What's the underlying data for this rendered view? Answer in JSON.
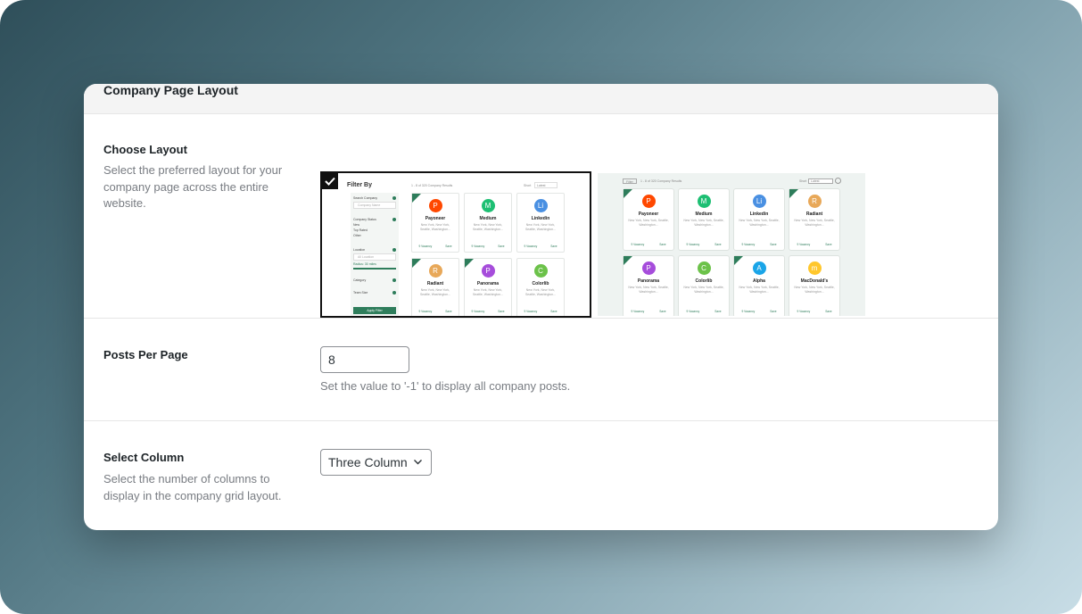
{
  "section": {
    "title": "Company Page Layout"
  },
  "layout": {
    "label": "Choose Layout",
    "description": "Select the preferred layout for your company page across the entire website.",
    "option1": {
      "selected": true,
      "filter_by": "Filter By",
      "sidebar": {
        "search_label": "Search Company",
        "search_placeholder": "Company Name",
        "status_label": "Company Status",
        "status_options": [
          "New",
          "Top Rated",
          "Other"
        ],
        "location_label": "Location",
        "location_placeholder": "All Location",
        "radius_label": "Radius: 30 miles",
        "category_label": "Category",
        "team_size_label": "Team Size",
        "apply_label": "Apply Filter"
      },
      "results_text": "1 - 8 of 320 Company Results",
      "sort_label": "Short",
      "sort_value": "Latest",
      "cards": [
        {
          "name": "Payoneer",
          "logo": "P",
          "color": "#ff4800"
        },
        {
          "name": "Medium",
          "logo": "M",
          "color": "#1dbf73"
        },
        {
          "name": "Linkedin",
          "logo": "Li",
          "color": "#4a90e2"
        },
        {
          "name": "Radiant",
          "logo": "R",
          "color": "#e8a859"
        },
        {
          "name": "Panorama",
          "logo": "P",
          "color": "#a64ddb"
        },
        {
          "name": "Colorlib",
          "logo": "C",
          "color": "#6cc24a"
        }
      ]
    },
    "option2": {
      "selected": false,
      "filter_label": "Filter",
      "results_text": "1 - 8 of 320 Company Results",
      "sort_label": "Short",
      "sort_value": "Latest",
      "cards": [
        {
          "name": "Payoneer",
          "logo": "P",
          "color": "#ff4800"
        },
        {
          "name": "Medium",
          "logo": "M",
          "color": "#1dbf73"
        },
        {
          "name": "Linkedin",
          "logo": "Li",
          "color": "#4a90e2"
        },
        {
          "name": "Radiant",
          "logo": "R",
          "color": "#e8a859"
        },
        {
          "name": "Panorama",
          "logo": "P",
          "color": "#a64ddb"
        },
        {
          "name": "Colorlib",
          "logo": "C",
          "color": "#6cc24a"
        },
        {
          "name": "Alpha",
          "logo": "A",
          "color": "#1aa5e8"
        },
        {
          "name": "MacDonald's",
          "logo": "m",
          "color": "#ffc72c"
        }
      ]
    },
    "card_address": "New York, New York, Seattle, Washington...",
    "card_link_left": "9 Vacancy",
    "card_link_right": "Save"
  },
  "posts_per_page": {
    "label": "Posts Per Page",
    "value": "8",
    "help": "Set the value to '-1' to display all company posts."
  },
  "columns": {
    "label": "Select Column",
    "description": "Select the number of columns to display in the company grid layout.",
    "selected": "Three Column"
  },
  "colors": {
    "accent": "#2e7d5b",
    "selected_border": "#111111"
  }
}
